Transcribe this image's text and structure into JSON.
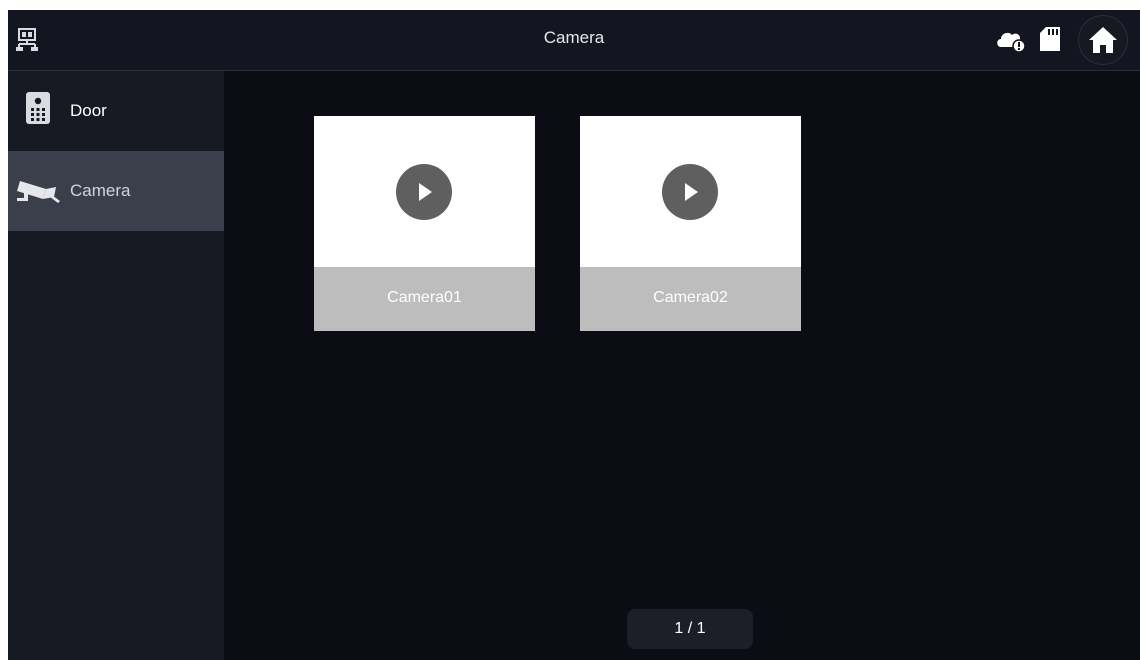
{
  "header": {
    "title": "Camera",
    "left_icon": "network-icon",
    "status_icons": [
      "cloud-alert-icon",
      "sd-card-icon"
    ],
    "home_icon": "home-icon"
  },
  "sidebar": {
    "items": [
      {
        "label": "Door",
        "icon": "door-station-icon",
        "active": false
      },
      {
        "label": "Camera",
        "icon": "cctv-camera-icon",
        "active": true
      }
    ]
  },
  "cameras": [
    {
      "name": "Camera01",
      "icon": "play-icon"
    },
    {
      "name": "Camera02",
      "icon": "play-icon"
    }
  ],
  "pager": {
    "text": "1 / 1"
  },
  "colors": {
    "background": "#0b0c14",
    "header": "#131520",
    "sidebar": "#171923",
    "sidebar_active": "#3b3f4b",
    "card_label_bar": "#bdbdbd",
    "play_button": "#5f5f5f"
  }
}
